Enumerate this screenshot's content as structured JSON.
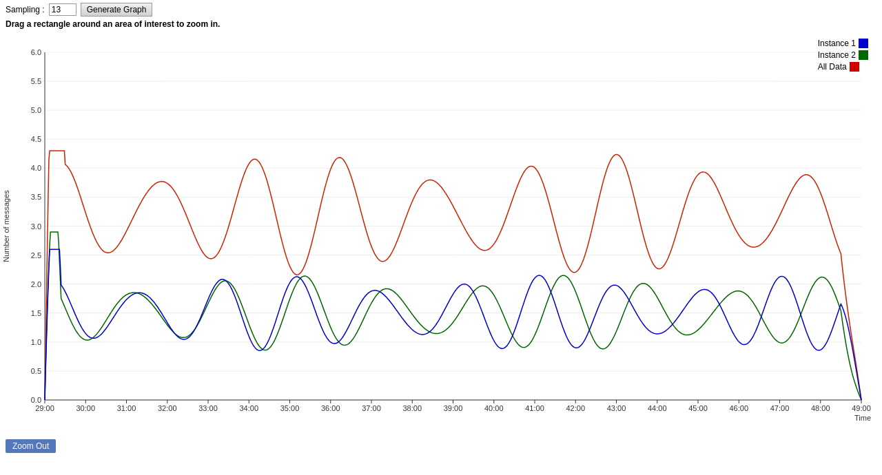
{
  "controls": {
    "sampling_label": "Sampling :",
    "sampling_value": "13",
    "generate_button": "Generate Graph",
    "instruction": "Drag a rectangle around an area of interest to zoom in."
  },
  "legend": {
    "items": [
      {
        "label": "Instance 1",
        "color": "#0000cc"
      },
      {
        "label": "Instance 2",
        "color": "#006600"
      },
      {
        "label": "All Data",
        "color": "#cc0000"
      }
    ]
  },
  "chart": {
    "y_axis_label": "Number of messages",
    "x_axis_label": "Time",
    "y_max": 6.0,
    "y_min": 0.0,
    "x_start": "29:00",
    "x_end": "49:00",
    "zoom_out_label": "Zoom Out"
  }
}
